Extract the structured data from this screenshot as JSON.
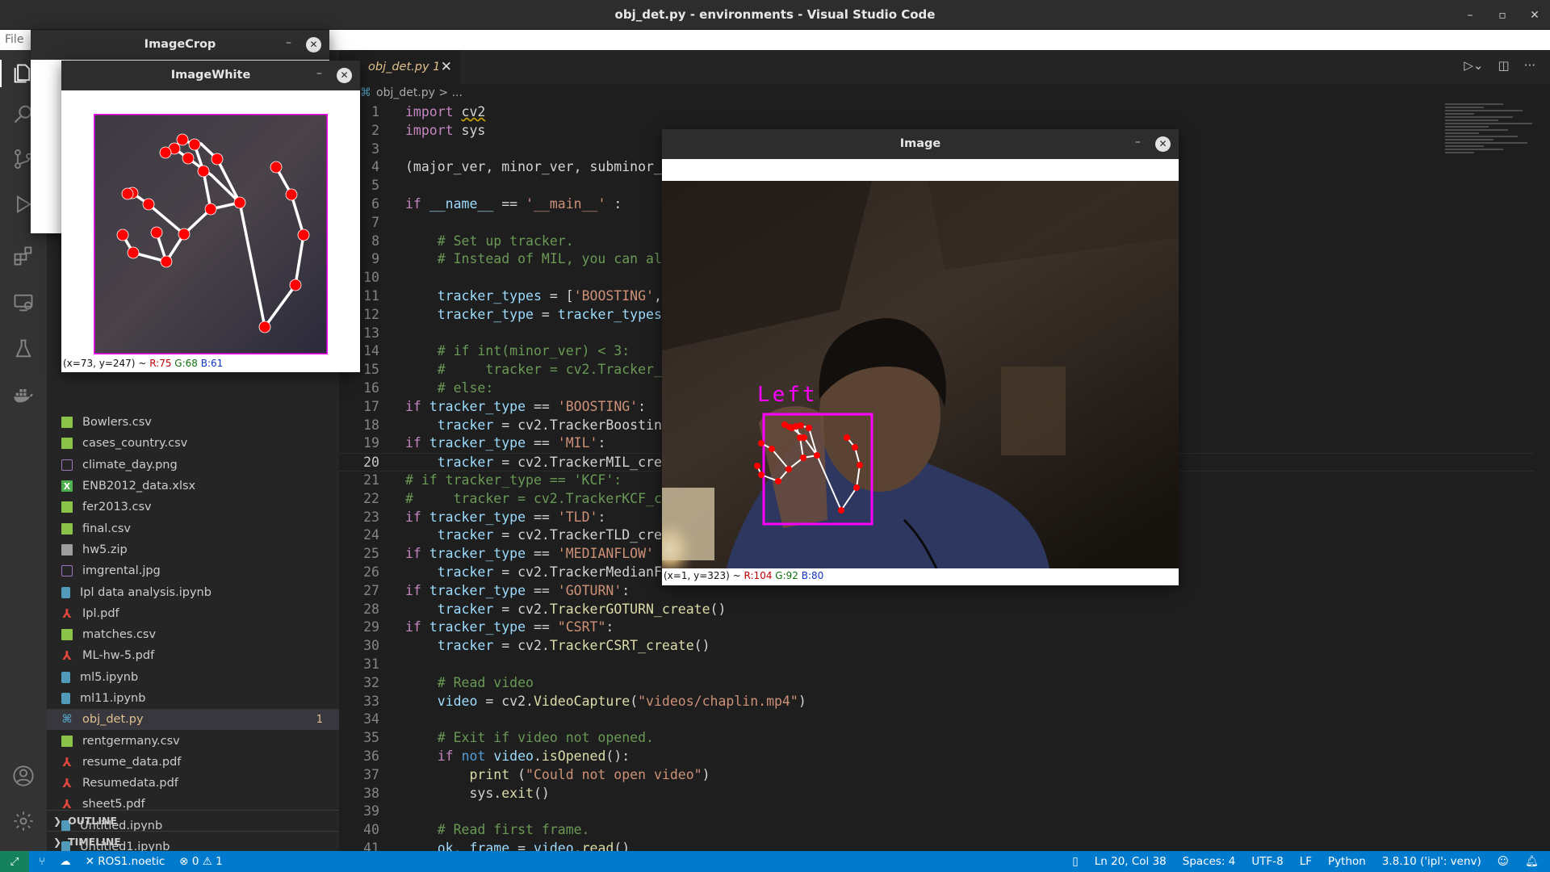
{
  "window": {
    "title": "obj_det.py - environments - Visual Studio Code",
    "controls": [
      "–",
      "▫",
      "✕"
    ]
  },
  "menubar": {
    "file": "File"
  },
  "activity_icons": [
    "files-icon",
    "search-icon",
    "source-control-icon",
    "run-debug-icon",
    "extensions-icon",
    "remote-explorer-icon",
    "testing-icon",
    "docker-icon",
    "accounts-icon",
    "settings-gear-icon"
  ],
  "explorer": {
    "files": [
      {
        "name": "Bowlers.csv",
        "type": "csv"
      },
      {
        "name": "cases_country.csv",
        "type": "csv"
      },
      {
        "name": "climate_day.png",
        "type": "png"
      },
      {
        "name": "ENB2012_data.xlsx",
        "type": "xlsx"
      },
      {
        "name": "fer2013.csv",
        "type": "csv"
      },
      {
        "name": "final.csv",
        "type": "csv"
      },
      {
        "name": "hw5.zip",
        "type": "zip"
      },
      {
        "name": "imgrental.jpg",
        "type": "png"
      },
      {
        "name": "Ipl data analysis.ipynb",
        "type": "ipynb"
      },
      {
        "name": "Ipl.pdf",
        "type": "pdf"
      },
      {
        "name": "matches.csv",
        "type": "csv"
      },
      {
        "name": "ML-hw-5.pdf",
        "type": "pdf"
      },
      {
        "name": "ml5.ipynb",
        "type": "ipynb"
      },
      {
        "name": "ml11.ipynb",
        "type": "ipynb"
      },
      {
        "name": "obj_det.py",
        "type": "py",
        "active": true,
        "badge": "1"
      },
      {
        "name": "rentgermany.csv",
        "type": "csv"
      },
      {
        "name": "resume_data.pdf",
        "type": "pdf"
      },
      {
        "name": "Resumedata.pdf",
        "type": "pdf"
      },
      {
        "name": "sheet5.pdf",
        "type": "pdf"
      },
      {
        "name": "Untitled.ipynb",
        "type": "ipynb"
      },
      {
        "name": "Untitled1.ipynb",
        "type": "ipynb"
      }
    ],
    "outline": "OUTLINE",
    "timeline": "TIMELINE"
  },
  "tab": {
    "label": "obj_det.py 1",
    "close": "✕"
  },
  "breadcrumb": {
    "file": "obj_det.py",
    "rest": "> ..."
  },
  "editor": {
    "current_line": 20,
    "lines": [
      {
        "n": 1,
        "html": "<span class=\"k\">import</span> <span class=\"sq\">cv2</span>"
      },
      {
        "n": 2,
        "html": "<span class=\"k\">import</span> sys"
      },
      {
        "n": 3,
        "html": ""
      },
      {
        "n": 4,
        "html": "(major_ver, minor_ver, subminor_"
      },
      {
        "n": 5,
        "html": ""
      },
      {
        "n": 6,
        "html": "<span class=\"k\">if</span> <span class=\"v\">__name__</span> == <span class=\"s\">'__main__'</span> :"
      },
      {
        "n": 7,
        "html": ""
      },
      {
        "n": 8,
        "html": "    <span class=\"c\"># Set up tracker.</span>"
      },
      {
        "n": 9,
        "html": "    <span class=\"c\"># Instead of MIL, you can al</span>"
      },
      {
        "n": 10,
        "html": ""
      },
      {
        "n": 11,
        "html": "    <span class=\"v\">tracker_types</span> = [<span class=\"s\">'BOOSTING'</span>,"
      },
      {
        "n": 12,
        "html": "    <span class=\"v\">tracker_type</span> = <span class=\"v\">tracker_types</span>"
      },
      {
        "n": 13,
        "html": ""
      },
      {
        "n": 14,
        "html": "    <span class=\"c\"># if int(minor_ver) &lt; 3:</span>"
      },
      {
        "n": 15,
        "html": "    <span class=\"c\">#     tracker = cv2.Tracker_</span>"
      },
      {
        "n": 16,
        "html": "    <span class=\"c\"># else:</span>"
      },
      {
        "n": 17,
        "html": "<span class=\"k\">if</span> <span class=\"v\">tracker_type</span> == <span class=\"s\">'BOOSTING'</span>:"
      },
      {
        "n": 18,
        "html": "    <span class=\"v\">tracker</span> = cv2.TrackerBoostin"
      },
      {
        "n": 19,
        "html": "<span class=\"k\">if</span> <span class=\"v\">tracker_type</span> == <span class=\"s\">'MIL'</span>:"
      },
      {
        "n": 20,
        "html": "    <span class=\"v\">tracker</span> = cv2.TrackerMIL_cre"
      },
      {
        "n": 21,
        "html": "<span class=\"c\"># if tracker_type == 'KCF':</span>"
      },
      {
        "n": 22,
        "html": "<span class=\"c\">#     tracker = cv2.TrackerKCF_c</span>"
      },
      {
        "n": 23,
        "html": "<span class=\"k\">if</span> <span class=\"v\">tracker_type</span> == <span class=\"s\">'TLD'</span>:"
      },
      {
        "n": 24,
        "html": "    <span class=\"v\">tracker</span> = cv2.TrackerTLD_cre"
      },
      {
        "n": 25,
        "html": "<span class=\"k\">if</span> <span class=\"v\">tracker_type</span> == <span class=\"s\">'MEDIANFLOW'</span>"
      },
      {
        "n": 26,
        "html": "    <span class=\"v\">tracker</span> = cv2.TrackerMedianF"
      },
      {
        "n": 27,
        "html": "<span class=\"k\">if</span> <span class=\"v\">tracker_type</span> == <span class=\"s\">'GOTURN'</span>:"
      },
      {
        "n": 28,
        "html": "    <span class=\"v\">tracker</span> = cv2.<span class=\"f\">TrackerGOTURN_create</span>()"
      },
      {
        "n": 29,
        "html": "<span class=\"k\">if</span> <span class=\"v\">tracker_type</span> == <span class=\"s\">\"CSRT\"</span>:"
      },
      {
        "n": 30,
        "html": "    <span class=\"v\">tracker</span> = cv2.<span class=\"f\">TrackerCSRT_create</span>()"
      },
      {
        "n": 31,
        "html": ""
      },
      {
        "n": 32,
        "html": "    <span class=\"c\"># Read video</span>"
      },
      {
        "n": 33,
        "html": "    <span class=\"v\">video</span> = cv2.<span class=\"f\">VideoCapture</span>(<span class=\"s\">\"videos/chaplin.mp4\"</span>)"
      },
      {
        "n": 34,
        "html": ""
      },
      {
        "n": 35,
        "html": "    <span class=\"c\"># Exit if video not opened.</span>"
      },
      {
        "n": 36,
        "html": "    <span class=\"k\">if</span> <span class=\"kw\">not</span> <span class=\"v\">video</span>.<span class=\"f\">isOpened</span>():"
      },
      {
        "n": 37,
        "html": "        <span class=\"f\">print</span> (<span class=\"s\">\"Could not open video\"</span>)"
      },
      {
        "n": 38,
        "html": "        sys.<span class=\"f\">exit</span>()"
      },
      {
        "n": 39,
        "html": ""
      },
      {
        "n": 40,
        "html": "    <span class=\"c\"># Read first frame.</span>"
      },
      {
        "n": 41,
        "html": "    <span class=\"v\">ok</span>, <span class=\"v\">frame</span> = <span class=\"v\">video</span>.<span class=\"f\">read</span>()"
      }
    ]
  },
  "statusbar": {
    "ros": "ROS1.noetic",
    "problems": "⊗ 0 ⚠ 1",
    "position": "Ln 20, Col 38",
    "spaces": "Spaces: 4",
    "encoding": "UTF-8",
    "eol": "LF",
    "language": "Python",
    "interpreter": "3.8.10 ('ipl': venv)"
  },
  "cv_windows": {
    "crop": {
      "title": "ImageCrop"
    },
    "white": {
      "title": "ImageWhite",
      "status_prefix": "(x=73, y=247) ~",
      "r": "R:75",
      "g": "G:68",
      "b": "B:61"
    },
    "image": {
      "title": "Image",
      "label": "Left",
      "status_prefix": "(x=1, y=323) ~",
      "r": "R:104",
      "g": "G:92",
      "b": "B:80"
    },
    "minimize": "–",
    "close": "✕"
  },
  "colors": {
    "accent": "#007acc",
    "landmark": "#ff0000",
    "bbox": "#ff00ff",
    "active_file": "#e2c08d"
  }
}
